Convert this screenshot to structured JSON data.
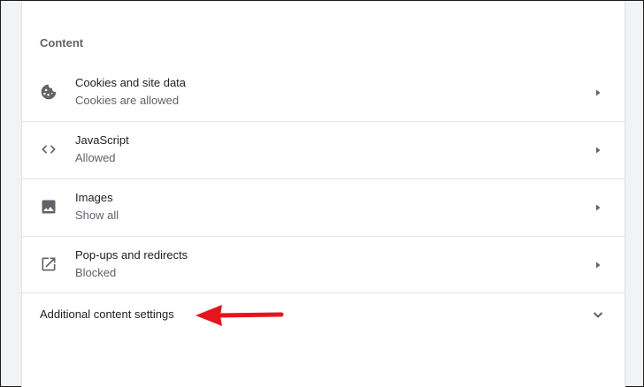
{
  "section": {
    "title": "Content"
  },
  "rows": [
    {
      "icon": "cookie-icon",
      "title": "Cookies and site data",
      "status": "Cookies are allowed"
    },
    {
      "icon": "code-icon",
      "title": "JavaScript",
      "status": "Allowed"
    },
    {
      "icon": "image-icon",
      "title": "Images",
      "status": "Show all"
    },
    {
      "icon": "open-in-new-icon",
      "title": "Pop-ups and redirects",
      "status": "Blocked"
    }
  ],
  "additional": {
    "label": "Additional content settings",
    "icon": "chevron-down-icon"
  },
  "annotation": {
    "icon": "red-arrow-icon",
    "color": "#e8141b"
  },
  "colors": {
    "icon": "#5f6368",
    "primary_text": "#202124",
    "secondary_text": "#5f6368"
  }
}
